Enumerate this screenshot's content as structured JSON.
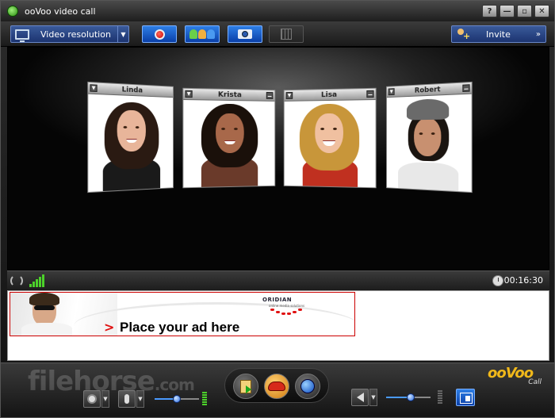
{
  "window": {
    "title": "ooVoo video call",
    "controls": [
      "?",
      "—",
      "▫",
      "✕"
    ]
  },
  "toolbar": {
    "resolution_label": "Video resolution",
    "invite_label": "Invite",
    "invite_arrows": "»"
  },
  "participants": [
    {
      "name": "Linda"
    },
    {
      "name": "Krista"
    },
    {
      "name": "Lisa"
    },
    {
      "name": "Robert"
    }
  ],
  "status": {
    "signal_bars": 5,
    "call_timer": "00:16:30"
  },
  "ad": {
    "brand": "ORIDIAN",
    "tagline": "online media solutions",
    "arrow": ">",
    "text": "Place your ad here"
  },
  "bottom": {
    "watermark_main": "filehorse",
    "watermark_suffix": ".com",
    "logo_text": "ooVoo",
    "logo_sub": "Call"
  },
  "audio": {
    "mic_level": 0.5,
    "speaker_level": 0.55
  },
  "colors": {
    "accent_blue": "#2e7fe6",
    "record_red": "#c00",
    "signal_green": "#4cd12a",
    "logo_gold": "#f0b81a"
  }
}
